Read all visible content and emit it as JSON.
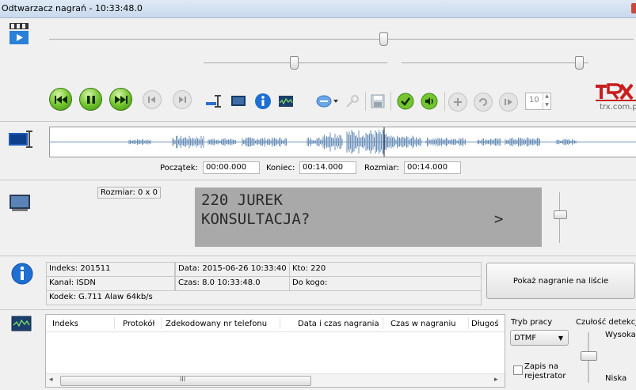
{
  "window": {
    "title": "Odtwarzacz nagrań - 10:33:48.0"
  },
  "brand": {
    "logo": "TRX",
    "url": "trx.com.pl"
  },
  "toolbar": {
    "speed_value": "10"
  },
  "waveform": {
    "start_label": "Początek:",
    "start_value": "00:00.000",
    "end_label": "Koniec:",
    "end_value": "00:14.000",
    "size_label": "Rozmiar:",
    "size_value": "00:14.000",
    "playhead_fraction": 0.57
  },
  "video": {
    "size_label": "Rozmiar: 0 x 0",
    "display_line1": "220 JUREK",
    "display_line2": "KONSULTACJA?",
    "display_arrow": ">"
  },
  "info": {
    "index": "Indeks: 201511",
    "channel": "Kanał: ISDN",
    "codec": "Kodek: G.711 Alaw 64kb/s",
    "date": "Data: 2015-06-26 10:33:40",
    "time": "Czas: 8.0  10:33:48.0",
    "who": "Kto: 220",
    "to_whom": "Do kogo:",
    "show_button": "Pokaż nagranie na liście"
  },
  "decoder": {
    "columns": [
      "Indeks",
      "Protokół",
      "Zdekodowany nr telefonu",
      "Data i czas nagrania",
      "Czas w nagraniu",
      "Długoś"
    ],
    "mode_label": "Tryb pracy",
    "mode_value": "DTMF",
    "sensitivity_label": "Czułość detekcji",
    "high_label": "Wysoka",
    "low_label": "Niska",
    "record_label_1": "Zapis na",
    "record_label_2": "rejestrator",
    "scroll_mark": "III"
  },
  "colors": {
    "accent_green": "#6fc22a",
    "display_bg": "#a9a9a9",
    "brand_red": "#c81e1e",
    "wave": "#6a8fb8"
  }
}
